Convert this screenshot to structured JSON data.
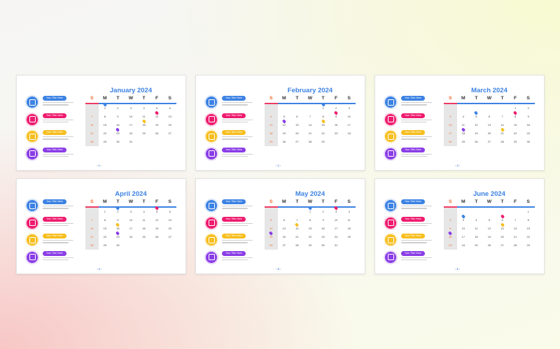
{
  "colors": {
    "blue": "#3c82e3",
    "pink": "#ee1b6e",
    "yellow": "#f7be1e",
    "purple": "#8a3de6"
  },
  "dow": [
    "S",
    "M",
    "T",
    "W",
    "T",
    "F",
    "S"
  ],
  "legend": [
    {
      "icon": "calendar-icon",
      "color": "#3c82e3",
      "title": "Your Title Here"
    },
    {
      "icon": "monitor-icon",
      "color": "#ee1b6e",
      "title": "Your Title Here"
    },
    {
      "icon": "chat-icon",
      "color": "#f7be1e",
      "title": "Your Title Here"
    },
    {
      "icon": "document-icon",
      "color": "#8a3de6",
      "title": "Your Title Here"
    }
  ],
  "months": [
    {
      "title": "January 2024",
      "page": "1",
      "start": 1,
      "days": 31,
      "pins": [
        {
          "day": 1,
          "color": "#3c82e3"
        },
        {
          "day": 12,
          "color": "#ee1b6e"
        },
        {
          "day": 18,
          "color": "#f7be1e"
        },
        {
          "day": 23,
          "color": "#8a3de6"
        }
      ]
    },
    {
      "title": "February 2024",
      "page": "2",
      "start": 4,
      "days": 29,
      "pins": [
        {
          "day": 1,
          "color": "#3c82e3"
        },
        {
          "day": 9,
          "color": "#ee1b6e"
        },
        {
          "day": 12,
          "color": "#8a3de6"
        },
        {
          "day": 15,
          "color": "#f7be1e"
        }
      ]
    },
    {
      "title": "March 2024",
      "page": "3",
      "start": 5,
      "days": 31,
      "pins": [
        {
          "day": 5,
          "color": "#3c82e3"
        },
        {
          "day": 8,
          "color": "#ee1b6e"
        },
        {
          "day": 18,
          "color": "#8a3de6"
        },
        {
          "day": 21,
          "color": "#f7be1e"
        }
      ]
    },
    {
      "title": "April 2024",
      "page": "4",
      "start": 1,
      "days": 30,
      "pins": [
        {
          "day": 2,
          "color": "#3c82e3"
        },
        {
          "day": 5,
          "color": "#ee1b6e"
        },
        {
          "day": 16,
          "color": "#f7be1e"
        },
        {
          "day": 23,
          "color": "#8a3de6"
        }
      ]
    },
    {
      "title": "May 2024",
      "page": "5",
      "start": 3,
      "days": 31,
      "pins": [
        {
          "day": 1,
          "color": "#3c82e3"
        },
        {
          "day": 3,
          "color": "#ee1b6e"
        },
        {
          "day": 14,
          "color": "#f7be1e"
        },
        {
          "day": 19,
          "color": "#8a3de6"
        }
      ]
    },
    {
      "title": "June 2024",
      "page": "6",
      "start": 6,
      "days": 30,
      "pins": [
        {
          "day": 3,
          "color": "#3c82e3"
        },
        {
          "day": 6,
          "color": "#ee1b6e"
        },
        {
          "day": 13,
          "color": "#f7be1e"
        },
        {
          "day": 16,
          "color": "#8a3de6"
        }
      ]
    }
  ]
}
